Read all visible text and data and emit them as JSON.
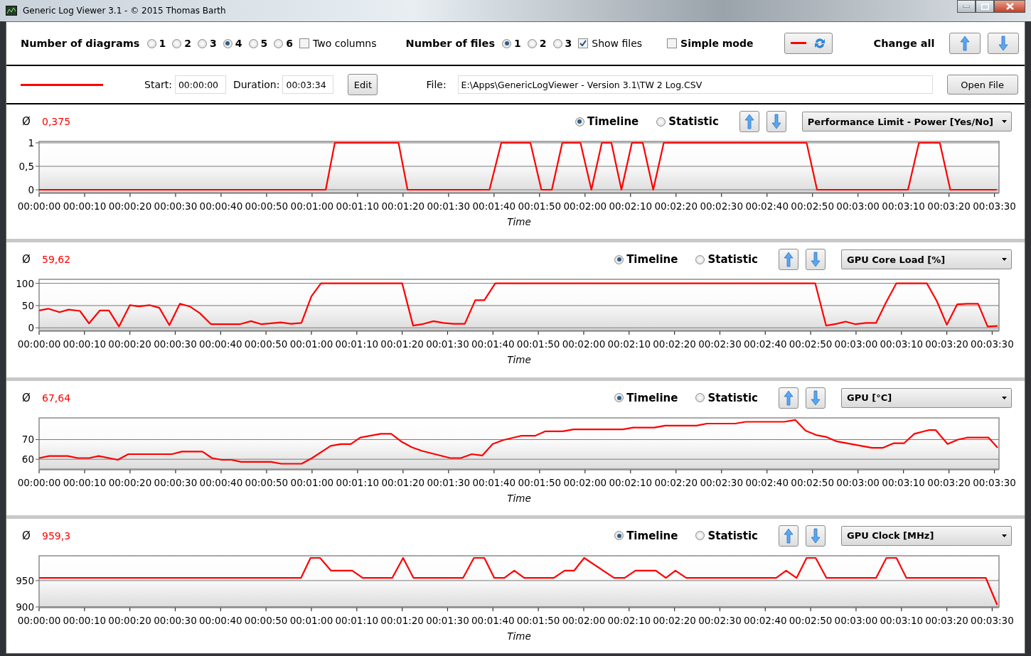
{
  "window": {
    "title": "Generic Log Viewer 3.1 - © 2015 Thomas Barth"
  },
  "top_bar": {
    "diagram_count": {
      "label": "Number of diagrams",
      "options": [
        {
          "label": "1",
          "selected": false
        },
        {
          "label": "2",
          "selected": false
        },
        {
          "label": "3",
          "selected": false
        },
        {
          "label": "4",
          "selected": true
        },
        {
          "label": "5",
          "selected": false
        },
        {
          "label": "6",
          "selected": false
        }
      ]
    },
    "two_columns": {
      "label": "Two columns",
      "checked": false
    },
    "file_count": {
      "label": "Number of files",
      "options": [
        {
          "label": "1",
          "selected": true
        },
        {
          "label": "2",
          "selected": false
        },
        {
          "label": "3",
          "selected": false
        }
      ]
    },
    "show_files": {
      "label": "Show files",
      "checked": true
    },
    "simple_mode": {
      "label": "Simple mode",
      "checked": false
    },
    "change_all": "Change all"
  },
  "file_row": {
    "color": "#ff0000",
    "start_label": "Start:",
    "start": "00:00:00",
    "duration_label": "Duration:",
    "duration": "00:03:34",
    "edit_button": "Edit",
    "file_label": "File:",
    "file": "E:\\Apps\\GenericLogViewer - Version 3.1\\TW 2 Log.CSV",
    "open_button": "Open File"
  },
  "diagrams": [
    {
      "average_symbol": "Ø",
      "average": "0,375",
      "views": [
        {
          "label": "Timeline",
          "selected": true
        },
        {
          "label": "Statistic",
          "selected": false
        }
      ],
      "channel": "Performance Limit - Power [Yes/No]",
      "chart_data": {
        "type": "line",
        "grid": true,
        "xlabel": "Time",
        "xlim": [
          0,
          211
        ],
        "ylim": [
          -0.06,
          1.03
        ],
        "yticks": [
          0,
          {
            "value": 0.5,
            "label": "0,5"
          },
          1
        ],
        "xticks": [
          {
            "value": 0,
            "label": "00:00:00"
          },
          {
            "value": 10,
            "label": "00:00:10"
          },
          {
            "value": 20,
            "label": "00:00:20"
          },
          {
            "value": 30,
            "label": "00:00:30"
          },
          {
            "value": 40,
            "label": "00:00:40"
          },
          {
            "value": 50,
            "label": "00:00:50"
          },
          {
            "value": 60,
            "label": "00:01:00"
          },
          {
            "value": 70,
            "label": "00:01:10"
          },
          {
            "value": 80,
            "label": "00:01:20"
          },
          {
            "value": 90,
            "label": "00:01:30"
          },
          {
            "value": 100,
            "label": "00:01:40"
          },
          {
            "value": 110,
            "label": "00:01:50"
          },
          {
            "value": 120,
            "label": "00:02:00"
          },
          {
            "value": 130,
            "label": "00:02:10"
          },
          {
            "value": 140,
            "label": "00:02:20"
          },
          {
            "value": 150,
            "label": "00:02:30"
          },
          {
            "value": 160,
            "label": "00:02:40"
          },
          {
            "value": 170,
            "label": "00:02:50"
          },
          {
            "value": 180,
            "label": "00:03:00"
          },
          {
            "value": 190,
            "label": "00:03:10"
          },
          {
            "value": 200,
            "label": "00:03:20"
          },
          {
            "value": 210,
            "label": "00:03:30"
          }
        ],
        "x": [
          0,
          63,
          65,
          79,
          81,
          99,
          101.6,
          108,
          110.4,
          112.7,
          115,
          119,
          121.4,
          123.7,
          125.8,
          128,
          130.3,
          132.7,
          135,
          137.3,
          168.7,
          171,
          191,
          193.4,
          198,
          200.3,
          210.5
        ],
        "series": [
          {
            "color": "#ff0000",
            "values": [
              0,
              0,
              1,
              1,
              0,
              0,
              1,
              1,
              0,
              0,
              1,
              1,
              0,
              1,
              1,
              0,
              1,
              1,
              0,
              1,
              1,
              0,
              0,
              1,
              1,
              0,
              0
            ]
          }
        ]
      }
    },
    {
      "average_symbol": "Ø",
      "average": "59,62",
      "views": [
        {
          "label": "Timeline",
          "selected": true
        },
        {
          "label": "Statistic",
          "selected": false
        }
      ],
      "channel": "GPU Core Load [%]",
      "chart_data": {
        "type": "line",
        "grid": true,
        "xlabel": "Time",
        "xlim": [
          0,
          211.5
        ],
        "ylim": [
          -6,
          109
        ],
        "yticks": [
          0,
          50,
          100
        ],
        "xticks": [
          {
            "value": 0,
            "label": "00:00:00"
          },
          {
            "value": 10,
            "label": "00:00:10"
          },
          {
            "value": 20,
            "label": "00:00:20"
          },
          {
            "value": 30,
            "label": "00:00:30"
          },
          {
            "value": 40,
            "label": "00:00:40"
          },
          {
            "value": 50,
            "label": "00:00:50"
          },
          {
            "value": 60,
            "label": "00:01:00"
          },
          {
            "value": 70,
            "label": "00:01:10"
          },
          {
            "value": 80,
            "label": "00:01:20"
          },
          {
            "value": 90,
            "label": "00:01:30"
          },
          {
            "value": 100,
            "label": "00:01:40"
          },
          {
            "value": 110,
            "label": "00:01:50"
          },
          {
            "value": 120,
            "label": "00:02:00"
          },
          {
            "value": 130,
            "label": "00:02:10"
          },
          {
            "value": 140,
            "label": "00:02:20"
          },
          {
            "value": 150,
            "label": "00:02:30"
          },
          {
            "value": 160,
            "label": "00:02:40"
          },
          {
            "value": 170,
            "label": "00:02:50"
          },
          {
            "value": 180,
            "label": "00:03:00"
          },
          {
            "value": 190,
            "label": "00:03:10"
          },
          {
            "value": 200,
            "label": "00:03:20"
          },
          {
            "value": 210,
            "label": "00:03:30"
          }
        ],
        "x": [
          0,
          2,
          4.5,
          6.5,
          9,
          11,
          13.4,
          15.4,
          17.6,
          20,
          22,
          24.3,
          26.5,
          28.7,
          31,
          33.2,
          35.4,
          37.9,
          44.2,
          46.7,
          49,
          53.3,
          55.5,
          57.8,
          60,
          62.1,
          64.3,
          77.6,
          80,
          82.4,
          84.4,
          86.9,
          89.1,
          91.3,
          93.8,
          96.1,
          98.1,
          100.5,
          166.4,
          168.7,
          171,
          173.4,
          175.7,
          177.7,
          179.9,
          182.2,
          184.4,
          186.6,
          188.9,
          191.3,
          195.6,
          197.8,
          200,
          202.3,
          204.5,
          206.9,
          209,
          211.2
        ],
        "series": [
          {
            "color": "#ff0000",
            "values": [
              39,
              43,
              35,
              41,
              38,
              10,
              39,
              39,
              3,
              51,
              48,
              51,
              45,
              6,
              54,
              48,
              33,
              8,
              8,
              15,
              8,
              12,
              9,
              11,
              71,
              100,
              100,
              100,
              100,
              5,
              8,
              15,
              11,
              9,
              9,
              62,
              62,
              100,
              100,
              100,
              100,
              5,
              9,
              14,
              8,
              11,
              11,
              57,
              100,
              100,
              100,
              60,
              7,
              53,
              54,
              54,
              3,
              4
            ]
          }
        ]
      }
    },
    {
      "average_symbol": "Ø",
      "average": "67,64",
      "views": [
        {
          "label": "Timeline",
          "selected": true
        },
        {
          "label": "Statistic",
          "selected": false
        }
      ],
      "channel": "GPU [°C]",
      "chart_data": {
        "type": "line",
        "grid": true,
        "xlabel": "Time",
        "xlim": [
          0,
          211
        ],
        "ylim": [
          55,
          81
        ],
        "yticks": [
          60,
          70
        ],
        "xticks": [
          {
            "value": 0,
            "label": "00:00:00"
          },
          {
            "value": 10,
            "label": "00:00:10"
          },
          {
            "value": 20,
            "label": "00:00:20"
          },
          {
            "value": 30,
            "label": "00:00:30"
          },
          {
            "value": 40,
            "label": "00:00:40"
          },
          {
            "value": 50,
            "label": "00:00:50"
          },
          {
            "value": 60,
            "label": "00:01:00"
          },
          {
            "value": 70,
            "label": "00:01:10"
          },
          {
            "value": 80,
            "label": "00:01:20"
          },
          {
            "value": 90,
            "label": "00:01:30"
          },
          {
            "value": 100,
            "label": "00:01:40"
          },
          {
            "value": 110,
            "label": "00:01:50"
          },
          {
            "value": 120,
            "label": "00:02:00"
          },
          {
            "value": 130,
            "label": "00:02:10"
          },
          {
            "value": 140,
            "label": "00:02:20"
          },
          {
            "value": 150,
            "label": "00:02:30"
          },
          {
            "value": 160,
            "label": "00:02:40"
          },
          {
            "value": 170,
            "label": "00:02:50"
          },
          {
            "value": 180,
            "label": "00:03:00"
          },
          {
            "value": 190,
            "label": "00:03:10"
          },
          {
            "value": 200,
            "label": "00:03:20"
          },
          {
            "value": 210,
            "label": "00:03:30"
          }
        ],
        "x": [
          0,
          2.2,
          6.3,
          8.5,
          11,
          13.1,
          17.3,
          19.6,
          29.2,
          31.4,
          35.9,
          38,
          40.2,
          42.3,
          44.4,
          51,
          53.2,
          57.7,
          60,
          64.1,
          66.3,
          68.5,
          70.6,
          75.1,
          77.4,
          79.6,
          81.9,
          84.2,
          90.4,
          92.7,
          95.1,
          97.4,
          99.7,
          102,
          105.9,
          109,
          111.3,
          115.1,
          117.5,
          128.3,
          130.6,
          135.2,
          137.6,
          144.5,
          146.8,
          153,
          155.3,
          163.8,
          166.2,
          168.5,
          170.8,
          173.1,
          175.4,
          183.1,
          185.5,
          187.8,
          190.1,
          192.4,
          195.5,
          197.1,
          199.7,
          202,
          204,
          208.7,
          210.7
        ],
        "series": [
          {
            "color": "#ff0000",
            "values": [
              60.6,
              61.6,
              61.6,
              60.6,
              60.6,
              61.6,
              59.7,
              62.6,
              62.6,
              63.9,
              63.9,
              60.6,
              59.7,
              59.7,
              58.7,
              58.7,
              57.7,
              57.7,
              60.6,
              66.8,
              67.7,
              67.7,
              71,
              72.9,
              72.9,
              69,
              66.1,
              64.2,
              60.6,
              60.6,
              62.6,
              61.9,
              67.7,
              69.7,
              71.9,
              71.9,
              74.2,
              74.2,
              75.2,
              75.2,
              76.1,
              76.1,
              77.1,
              77.1,
              78.1,
              78.1,
              79,
              79,
              80,
              74.5,
              72.3,
              71.3,
              69,
              65.8,
              65.8,
              68.1,
              68.1,
              72.9,
              74.8,
              74.8,
              67.7,
              70,
              71,
              71,
              65.8
            ]
          }
        ]
      }
    },
    {
      "average_symbol": "Ø",
      "average": "959,3",
      "views": [
        {
          "label": "Timeline",
          "selected": true
        },
        {
          "label": "Statistic",
          "selected": false
        }
      ],
      "channel": "GPU Clock [MHz]",
      "chart_data": {
        "type": "line",
        "grid": true,
        "xlabel": "Time",
        "xlim": [
          0,
          211.5
        ],
        "ylim": [
          900,
          997
        ],
        "yticks": [
          900,
          950
        ],
        "xticks": [
          {
            "value": 0,
            "label": "00:00:00"
          },
          {
            "value": 10,
            "label": "00:00:10"
          },
          {
            "value": 20,
            "label": "00:00:20"
          },
          {
            "value": 30,
            "label": "00:00:30"
          },
          {
            "value": 40,
            "label": "00:00:40"
          },
          {
            "value": 50,
            "label": "00:00:50"
          },
          {
            "value": 60,
            "label": "00:01:00"
          },
          {
            "value": 70,
            "label": "00:01:10"
          },
          {
            "value": 80,
            "label": "00:01:20"
          },
          {
            "value": 90,
            "label": "00:01:30"
          },
          {
            "value": 100,
            "label": "00:01:40"
          },
          {
            "value": 110,
            "label": "00:01:50"
          },
          {
            "value": 120,
            "label": "00:02:00"
          },
          {
            "value": 130,
            "label": "00:02:10"
          },
          {
            "value": 140,
            "label": "00:02:20"
          },
          {
            "value": 150,
            "label": "00:02:30"
          },
          {
            "value": 160,
            "label": "00:02:40"
          },
          {
            "value": 170,
            "label": "00:02:50"
          },
          {
            "value": 180,
            "label": "00:03:00"
          },
          {
            "value": 190,
            "label": "00:03:10"
          },
          {
            "value": 200,
            "label": "00:03:20"
          },
          {
            "value": 210,
            "label": "00:03:30"
          }
        ],
        "x": [
          0,
          57.7,
          59.8,
          61.9,
          64.3,
          69,
          71.3,
          77.8,
          80.2,
          82.5,
          93.4,
          95.8,
          98.1,
          100.3,
          102.5,
          104.7,
          106.9,
          113.4,
          115.8,
          117.9,
          120.1,
          126.7,
          129,
          131.4,
          135.9,
          138.1,
          140.2,
          142.6,
          162.4,
          164.6,
          166.9,
          169.1,
          171.1,
          173.5,
          184.4,
          186.7,
          188.9,
          191.1,
          208.6,
          211.1
        ],
        "series": [
          {
            "color": "#ff0000",
            "values": [
              955,
              955,
              993,
              993,
              969,
              969,
              955,
              955,
              993,
              955,
              955,
              993,
              993,
              955,
              955,
              969,
              955,
              955,
              969,
              969,
              993,
              955,
              955,
              969,
              969,
              955,
              969,
              955,
              955,
              969,
              955,
              993,
              993,
              955,
              955,
              993,
              993,
              955,
              955,
              904
            ]
          }
        ]
      }
    }
  ]
}
